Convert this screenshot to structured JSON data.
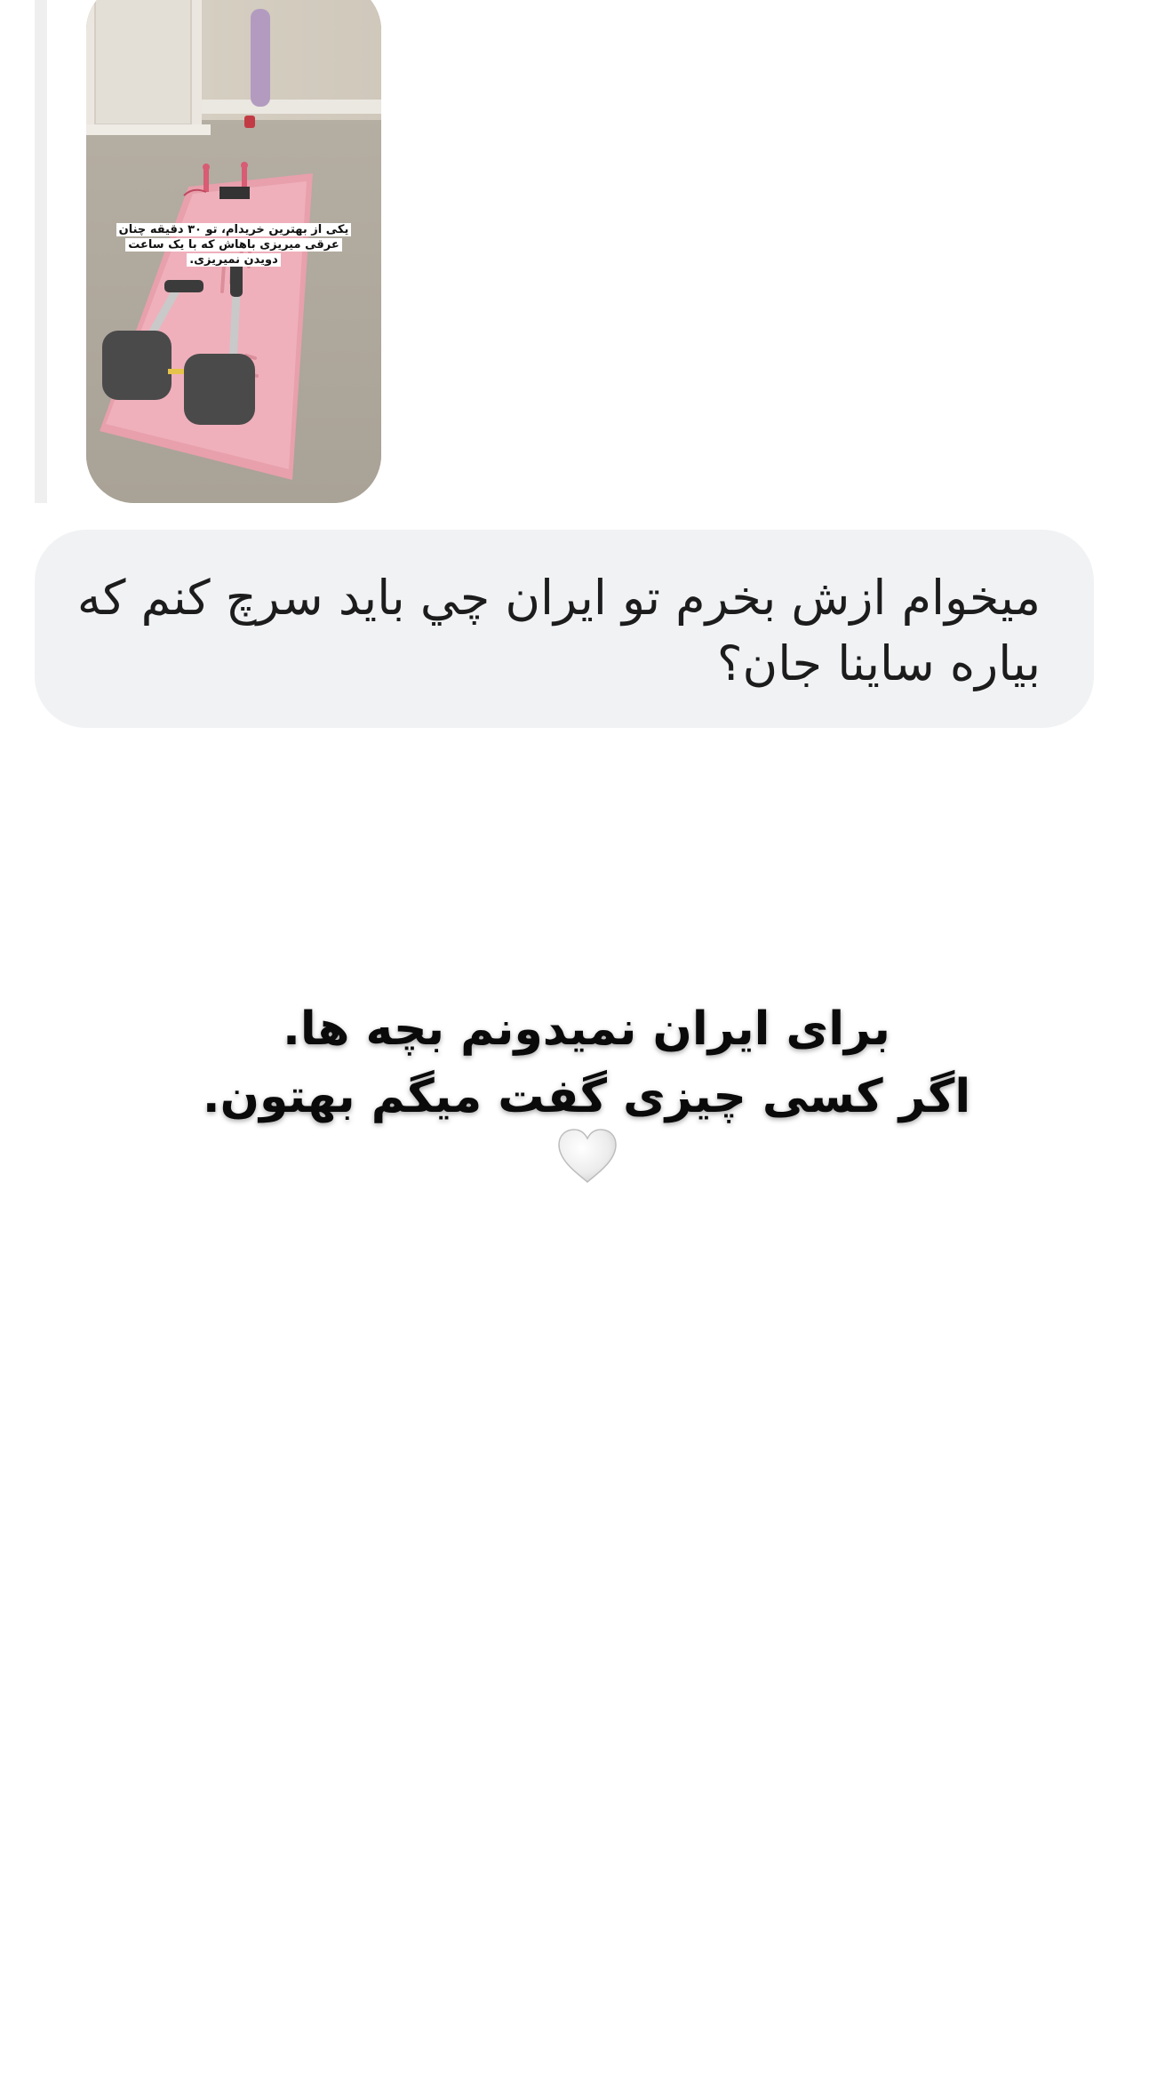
{
  "shared_post": {
    "image_caption_lines": [
      "یکی از بهترین خریدام، تو ۳۰ دقیقه چنان",
      "عرقی میریزی باهاش که با یک ساعت",
      "دویدن نمیریزی."
    ]
  },
  "message": {
    "text": "میخوام ازش بخرم تو ایران چي باید سرچ کنم که\nبیاره ساینا جان؟",
    "bubble_color": "#f1f2f4"
  },
  "story_overlay": {
    "lines": [
      "برای ایران نمیدونم بچه ها.",
      "اگر کسی چیزی گفت میگم بهتون."
    ],
    "emoji_icon": "white-heart-icon"
  },
  "colors": {
    "background": "#ffffff",
    "product_pink": "#eea2ae",
    "text": "#1c1c1c"
  }
}
